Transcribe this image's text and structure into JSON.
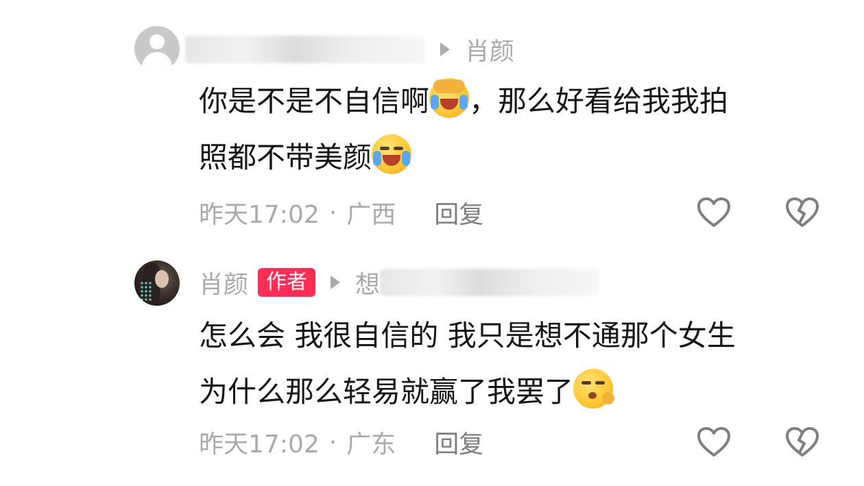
{
  "comments": [
    {
      "reply_target": "肖颜",
      "content_text": "你是不是不自信啊",
      "content_tail_1": "，那么好看给我我拍",
      "content_line2": "照都不带美颜",
      "time": "昨天17:02",
      "location": "广西",
      "reply_label": "回复",
      "emojis": [
        "laugh-cry-emoji",
        "crying-emoji"
      ]
    },
    {
      "username": "肖颜",
      "badge": "作者",
      "reply_target_visible": "想",
      "content_line1": "怎么会 我很自信的 我只是想不通那个女生",
      "content_line2": "为什么那么轻易就赢了我罢了",
      "time": "昨天17:02",
      "location": "广东",
      "reply_label": "回复",
      "emojis": [
        "shush-emoji"
      ]
    }
  ],
  "meta_separator": "·",
  "icons": [
    "heart-outline-icon",
    "broken-heart-icon",
    "reply-arrow-icon"
  ],
  "colors": {
    "badge": "#ff2c55",
    "meta": "#a9a9ae",
    "text": "#161616"
  }
}
